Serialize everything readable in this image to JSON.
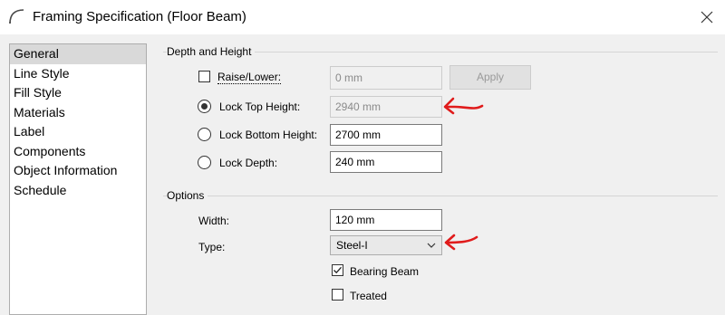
{
  "window": {
    "title": "Framing Specification (Floor Beam)",
    "close_icon": "close-icon",
    "app_icon": "arc-icon"
  },
  "sidebar": {
    "items": [
      "General",
      "Line Style",
      "Fill Style",
      "Materials",
      "Label",
      "Components",
      "Object Information",
      "Schedule"
    ],
    "selected": "General"
  },
  "depth_height": {
    "title": "Depth and Height",
    "raise_lower": {
      "label": "Raise/Lower:",
      "checked": false,
      "value": "0 mm"
    },
    "apply_label": "Apply",
    "lock_top": {
      "label": "Lock Top Height:",
      "selected": true,
      "value": "2940 mm"
    },
    "lock_bottom": {
      "label": "Lock Bottom Height:",
      "selected": false,
      "value": "2700 mm"
    },
    "lock_depth": {
      "label": "Lock Depth:",
      "selected": false,
      "value": "240 mm"
    }
  },
  "options": {
    "title": "Options",
    "width": {
      "label": "Width:",
      "value": "120 mm"
    },
    "type": {
      "label": "Type:",
      "value": "Steel-I"
    },
    "bearing_beam": {
      "label": "Bearing Beam",
      "checked": true
    },
    "treated": {
      "label": "Treated",
      "checked": false
    }
  },
  "annotations": {
    "color": "#e01b1b"
  }
}
